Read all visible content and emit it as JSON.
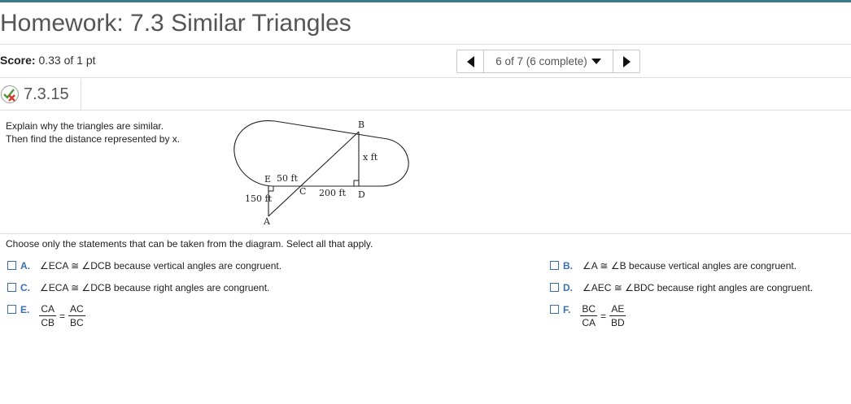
{
  "header": {
    "title": "Homework: 7.3 Similar Triangles",
    "score_label": "Score:",
    "score_value": "0.33 of 1 pt"
  },
  "navigator": {
    "position_label": "6 of 7 (6 complete)"
  },
  "question": {
    "number": "7.3.15",
    "prompt_line1": "Explain why the triangles are similar.",
    "prompt_line2": "Then find the distance represented by x."
  },
  "diagram": {
    "labels": {
      "B": "B",
      "x": "x ft",
      "E": "E",
      "ec": "50 ft",
      "C": "C",
      "cd": "200 ft",
      "D": "D",
      "ea": "150 ft",
      "A": "A"
    }
  },
  "instructions": "Choose only the statements that can be taken from the diagram. Select all that apply.",
  "options": {
    "A": {
      "letter": "A.",
      "text": "∠ECA ≅ ∠DCB because vertical angles are congruent."
    },
    "B": {
      "letter": "B.",
      "text": "∠A ≅ ∠B because vertical angles are congruent."
    },
    "C": {
      "letter": "C.",
      "text": "∠ECA ≅ ∠DCB because right angles are congruent."
    },
    "D": {
      "letter": "D.",
      "text": "∠AEC ≅ ∠BDC because right angles are congruent."
    },
    "E": {
      "letter": "E.",
      "num1": "CA",
      "den1": "CB",
      "eq": "=",
      "num2": "AC",
      "den2": "BC"
    },
    "F": {
      "letter": "F.",
      "num1": "BC",
      "den1": "CA",
      "eq": "=",
      "num2": "AE",
      "den2": "BD"
    }
  },
  "colors": {
    "accent_bar": "#3a7a8c",
    "option_letter": "#3a6fb0"
  }
}
